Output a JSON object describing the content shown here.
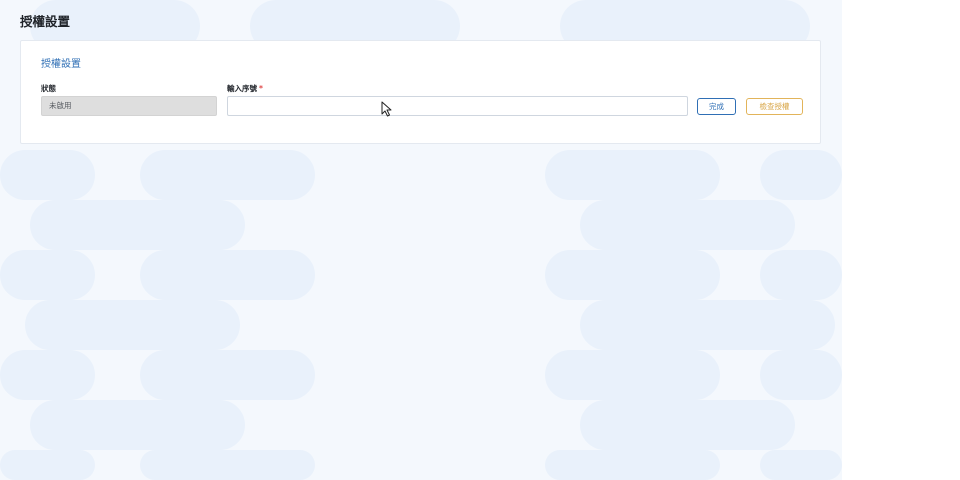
{
  "page": {
    "title": "授權設置"
  },
  "card": {
    "title": "授權設置",
    "status": {
      "label": "狀態",
      "value": "未啟用"
    },
    "serial": {
      "label": "輸入序號",
      "required_mark": "*",
      "value": "",
      "placeholder": ""
    },
    "buttons": {
      "done": "完成",
      "check": "檢查授權"
    }
  },
  "colors": {
    "accent": "#2f6fb5",
    "warning": "#d8a545",
    "required": "#e04b4b",
    "disabled_bg": "#dedede"
  },
  "icons": {
    "cursor": "mouse-pointer-icon"
  }
}
